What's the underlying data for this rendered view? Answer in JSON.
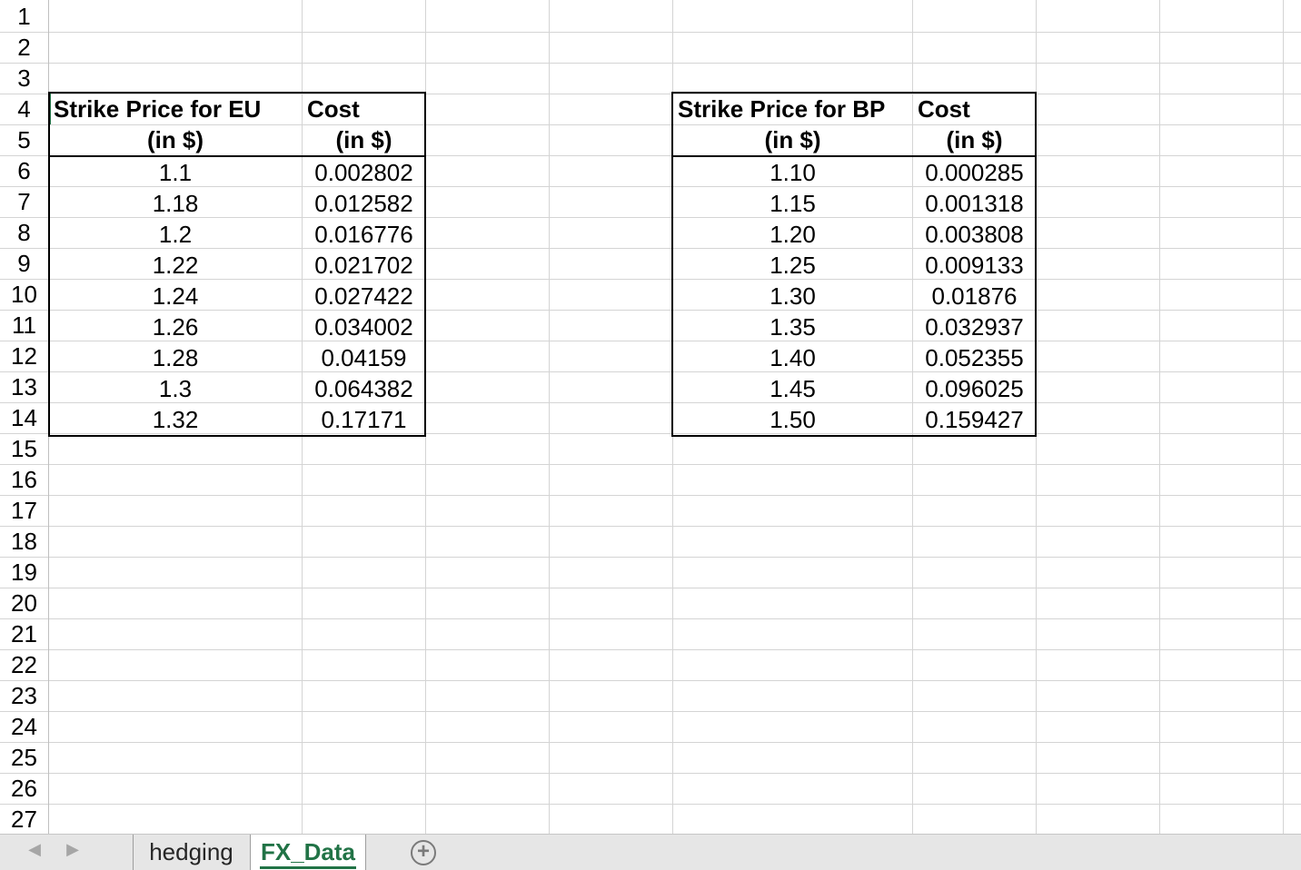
{
  "rows": [
    "1",
    "2",
    "3",
    "4",
    "5",
    "6",
    "7",
    "8",
    "9",
    "10",
    "11",
    "12",
    "13",
    "14",
    "15",
    "16",
    "17",
    "18",
    "19",
    "20",
    "21",
    "22",
    "23",
    "24",
    "25",
    "26",
    "27"
  ],
  "eu_table": {
    "header1": [
      "Strike Price for EU",
      "Cost"
    ],
    "header2": [
      "(in $)",
      "(in $)"
    ],
    "data": [
      [
        "1.1",
        "0.002802"
      ],
      [
        "1.18",
        "0.012582"
      ],
      [
        "1.2",
        "0.016776"
      ],
      [
        "1.22",
        "0.021702"
      ],
      [
        "1.24",
        "0.027422"
      ],
      [
        "1.26",
        "0.034002"
      ],
      [
        "1.28",
        "0.04159"
      ],
      [
        "1.3",
        "0.064382"
      ],
      [
        "1.32",
        "0.17171"
      ]
    ]
  },
  "bp_table": {
    "header1": [
      "Strike Price for BP",
      "Cost"
    ],
    "header2": [
      "(in $)",
      "(in $)"
    ],
    "data": [
      [
        "1.10",
        "0.000285"
      ],
      [
        "1.15",
        "0.001318"
      ],
      [
        "1.20",
        "0.003808"
      ],
      [
        "1.25",
        "0.009133"
      ],
      [
        "1.30",
        "0.01876"
      ],
      [
        "1.35",
        "0.032937"
      ],
      [
        "1.40",
        "0.052355"
      ],
      [
        "1.45",
        "0.096025"
      ],
      [
        "1.50",
        "0.159427"
      ]
    ]
  },
  "sheet_tabs": [
    {
      "label": "hedging",
      "active": false
    },
    {
      "label": "FX_Data",
      "active": true
    }
  ],
  "icons": {
    "scroll_left": "triangle-left-icon",
    "scroll_right": "triangle-right-icon",
    "new_sheet": "plus-circle-icon"
  },
  "colors": {
    "accent": "#217346",
    "gridline": "#d4d4d4",
    "tabbar_bg": "#e6e6e6"
  }
}
